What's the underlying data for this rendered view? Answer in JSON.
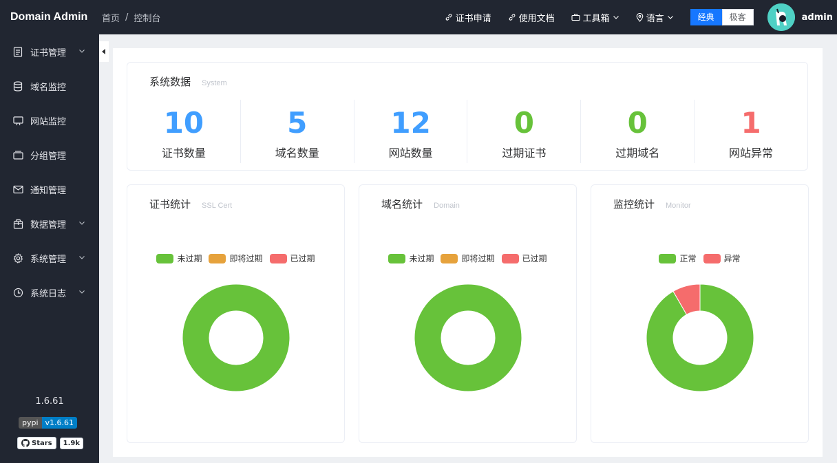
{
  "app": {
    "title": "Domain Admin"
  },
  "breadcrumb": {
    "home": "首页",
    "sep": "/",
    "current": "控制台"
  },
  "header": {
    "nav": [
      {
        "label": "证书申请",
        "icon": "link-icon"
      },
      {
        "label": "使用文档",
        "icon": "link-icon"
      },
      {
        "label": "工具箱",
        "icon": "briefcase-icon"
      },
      {
        "label": "语言",
        "icon": "location-icon"
      }
    ],
    "theme_classic": "经典",
    "theme_minimal": "极客",
    "username": "admin"
  },
  "sidebar": {
    "items": [
      {
        "label": "证书管理",
        "icon": "document-icon",
        "has_arrow": true
      },
      {
        "label": "域名监控",
        "icon": "database-icon",
        "has_arrow": false
      },
      {
        "label": "网站监控",
        "icon": "monitor-icon",
        "has_arrow": false
      },
      {
        "label": "分组管理",
        "icon": "group-icon",
        "has_arrow": false
      },
      {
        "label": "通知管理",
        "icon": "mail-icon",
        "has_arrow": false
      },
      {
        "label": "数据管理",
        "icon": "box-icon",
        "has_arrow": true
      },
      {
        "label": "系统管理",
        "icon": "gear-icon",
        "has_arrow": true
      },
      {
        "label": "系统日志",
        "icon": "clock-icon",
        "has_arrow": true
      }
    ],
    "version": "1.6.61",
    "pypi_label": "pypi",
    "pypi_version": "v1.6.61",
    "stars_label": "Stars",
    "stars_count": "1.9k"
  },
  "system": {
    "title": "系统数据",
    "subtitle": "System",
    "stats": [
      {
        "value": "10",
        "label": "证书数量",
        "color": "#409eff"
      },
      {
        "value": "5",
        "label": "域名数量",
        "color": "#409eff"
      },
      {
        "value": "12",
        "label": "网站数量",
        "color": "#409eff"
      },
      {
        "value": "0",
        "label": "过期证书",
        "color": "#67c23a"
      },
      {
        "value": "0",
        "label": "过期域名",
        "color": "#67c23a"
      },
      {
        "value": "1",
        "label": "网站异常",
        "color": "#f56c6c"
      }
    ]
  },
  "charts": {
    "ssl": {
      "title": "证书统计",
      "subtitle": "SSL Cert"
    },
    "domain": {
      "title": "域名统计",
      "subtitle": "Domain"
    },
    "monitor": {
      "title": "监控统计",
      "subtitle": "Monitor"
    }
  },
  "chart_data": [
    {
      "type": "pie",
      "categories": [
        "未过期",
        "即将过期",
        "已过期"
      ],
      "values": [
        10,
        0,
        0
      ],
      "colors": [
        "#67c23a",
        "#e6a23c",
        "#f56c6c"
      ],
      "legend": "top"
    },
    {
      "type": "pie",
      "categories": [
        "未过期",
        "即将过期",
        "已过期"
      ],
      "values": [
        5,
        0,
        0
      ],
      "colors": [
        "#67c23a",
        "#e6a23c",
        "#f56c6c"
      ],
      "legend": "top"
    },
    {
      "type": "pie",
      "categories": [
        "正常",
        "异常"
      ],
      "values": [
        11,
        1
      ],
      "colors": [
        "#67c23a",
        "#f56c6c"
      ],
      "legend": "top"
    }
  ]
}
